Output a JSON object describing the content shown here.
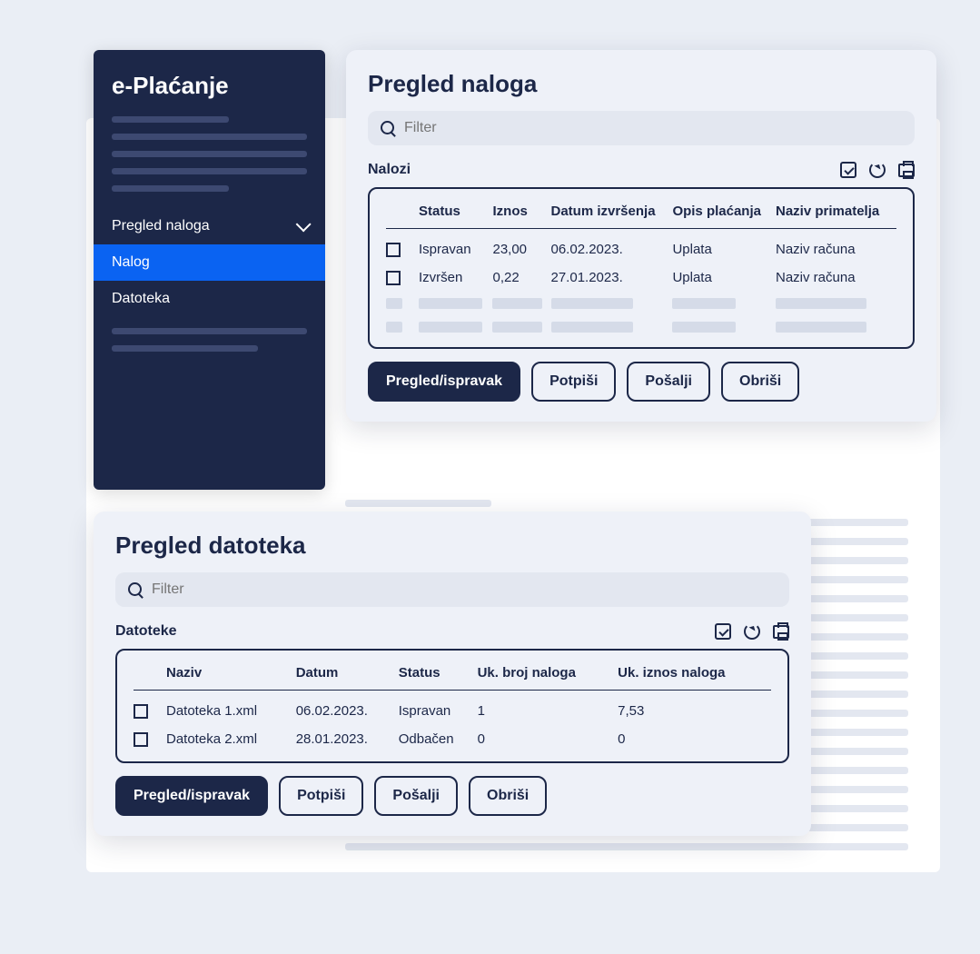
{
  "sidebar": {
    "title": "e-Plaćanje",
    "items": [
      {
        "label": "Pregled naloga",
        "expanded": true
      },
      {
        "label": "Nalog",
        "active": true
      },
      {
        "label": "Datoteka"
      }
    ]
  },
  "panel1": {
    "title": "Pregled naloga",
    "filter_placeholder": "Filter",
    "subheader": "Nalozi",
    "columns": [
      "Status",
      "Iznos",
      "Datum izvršenja",
      "Opis plaćanja",
      "Naziv primatelja"
    ],
    "rows": [
      {
        "status": "Ispravan",
        "iznos": "23,00",
        "datum": "06.02.2023.",
        "opis": "Uplata",
        "naziv": "Naziv računa"
      },
      {
        "status": "Izvršen",
        "iznos": "0,22",
        "datum": "27.01.2023.",
        "opis": "Uplata",
        "naziv": "Naziv računa"
      }
    ],
    "buttons": {
      "pregled": "Pregled/ispravak",
      "potpisi": "Potpiši",
      "posalji": "Pošalji",
      "obrisi": "Obriši"
    }
  },
  "panel2": {
    "title": "Pregled datoteka",
    "filter_placeholder": "Filter",
    "subheader": "Datoteke",
    "columns": [
      "Naziv",
      "Datum",
      "Status",
      "Uk. broj naloga",
      "Uk. iznos naloga"
    ],
    "rows": [
      {
        "naziv": "Datoteka 1.xml",
        "datum": "06.02.2023.",
        "status": "Ispravan",
        "broj": "1",
        "iznos": "7,53"
      },
      {
        "naziv": "Datoteka 2.xml",
        "datum": "28.01.2023.",
        "status": "Odbačen",
        "broj": "0",
        "iznos": "0"
      }
    ],
    "buttons": {
      "pregled": "Pregled/ispravak",
      "potpisi": "Potpiši",
      "posalji": "Pošalji",
      "obrisi": "Obriši"
    }
  }
}
